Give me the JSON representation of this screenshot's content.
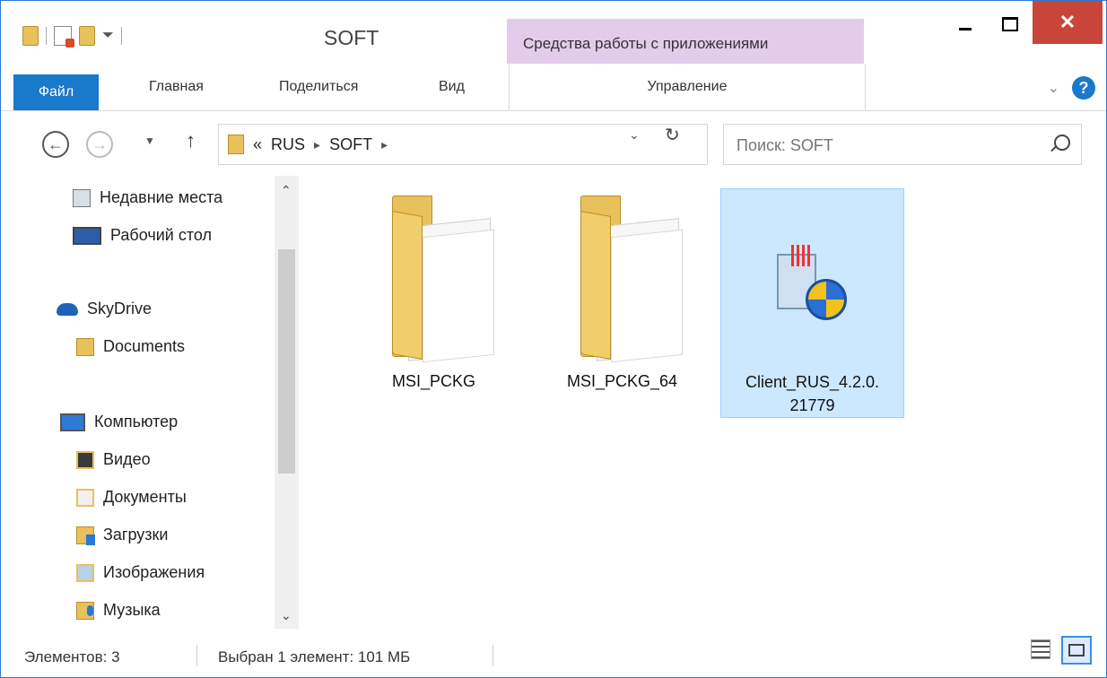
{
  "window": {
    "title": "SOFT",
    "context_tab_group": "Средства работы с приложениями",
    "close_glyph": "✕"
  },
  "ribbon": {
    "tabs": [
      {
        "label": "Файл"
      },
      {
        "label": "Главная"
      },
      {
        "label": "Поделиться"
      },
      {
        "label": "Вид"
      },
      {
        "label": "Управление"
      }
    ],
    "help_glyph": "?"
  },
  "address": {
    "breadcrumbs": [
      "«",
      "RUS",
      "SOFT"
    ],
    "search_placeholder": "Поиск: SOFT"
  },
  "nav_pane": {
    "items": [
      {
        "label": "Недавние места",
        "icon": "recent-places-icon"
      },
      {
        "label": "Рабочий стол",
        "icon": "desktop-icon"
      },
      {
        "label": "SkyDrive",
        "icon": "skydrive-icon"
      },
      {
        "label": "Documents",
        "icon": "folder-icon"
      },
      {
        "label": "Компьютер",
        "icon": "computer-icon"
      },
      {
        "label": "Видео",
        "icon": "videos-folder-icon"
      },
      {
        "label": "Документы",
        "icon": "documents-folder-icon"
      },
      {
        "label": "Загрузки",
        "icon": "downloads-folder-icon"
      },
      {
        "label": "Изображения",
        "icon": "pictures-folder-icon"
      },
      {
        "label": "Музыка",
        "icon": "music-folder-icon"
      }
    ]
  },
  "content": {
    "items": [
      {
        "name": "MSI_PCKG",
        "type": "folder",
        "selected": false
      },
      {
        "name": "MSI_PCKG_64",
        "type": "folder",
        "selected": false
      },
      {
        "name": "Client_RUS_4.2.0.21779",
        "name_line1": "Client_RUS_4.2.0.",
        "name_line2": "21779",
        "type": "installer",
        "selected": true
      }
    ]
  },
  "status": {
    "count": "Элементов: 3",
    "selection": "Выбран 1 элемент: 101 МБ"
  },
  "colors": {
    "accent": "#1979ca",
    "selection": "#cce8ff",
    "context_tab": "#e3cbec",
    "close": "#c9453a"
  }
}
